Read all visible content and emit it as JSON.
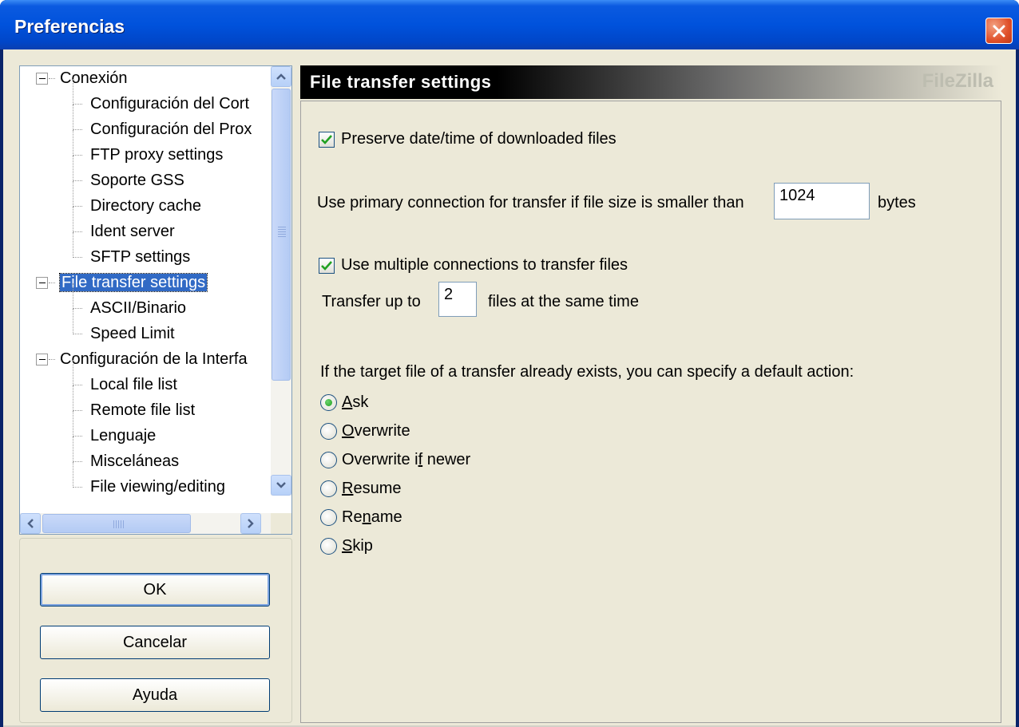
{
  "window": {
    "title": "Preferencias"
  },
  "tree": {
    "items": [
      {
        "label": "Conexión",
        "level": 0,
        "expanded": true
      },
      {
        "label": "Configuración del Cort",
        "level": 1
      },
      {
        "label": "Configuración del Prox",
        "level": 1
      },
      {
        "label": "FTP proxy settings",
        "level": 1
      },
      {
        "label": "Soporte GSS",
        "level": 1
      },
      {
        "label": "Directory cache",
        "level": 1
      },
      {
        "label": "Ident server",
        "level": 1
      },
      {
        "label": "SFTP settings",
        "level": 1
      },
      {
        "label": "File transfer settings",
        "level": 0,
        "expanded": true,
        "selected": true
      },
      {
        "label": "ASCII/Binario",
        "level": 1
      },
      {
        "label": "Speed Limit",
        "level": 1
      },
      {
        "label": "Configuración de la Interfa",
        "level": 0,
        "expanded": true
      },
      {
        "label": "Local file list",
        "level": 1
      },
      {
        "label": "Remote file list",
        "level": 1
      },
      {
        "label": "Lenguaje",
        "level": 1
      },
      {
        "label": "Misceláneas",
        "level": 1
      },
      {
        "label": "File viewing/editing",
        "level": 1
      }
    ]
  },
  "buttons": {
    "ok": "OK",
    "cancel": "Cancelar",
    "help": "Ayuda"
  },
  "page": {
    "header_title": "File transfer settings",
    "brand": "FileZilla",
    "preserve_date_label": "Preserve date/time of downloaded files",
    "preserve_date_checked": true,
    "primary_conn_prefix": "Use primary connection for transfer if file size is smaller than",
    "primary_conn_value": "1024",
    "primary_conn_suffix": "bytes",
    "multi_conn_label": "Use multiple connections to transfer files",
    "multi_conn_checked": true,
    "transfer_up_prefix": "Transfer up to",
    "transfer_up_value": "2",
    "transfer_up_suffix": "files at the same time",
    "exists_label": "If the target file of a transfer already exists, you can specify a default action:",
    "actions": [
      {
        "label": "Ask",
        "accel": 0,
        "selected": true
      },
      {
        "label": "Overwrite",
        "accel": 0,
        "selected": false
      },
      {
        "label": "Overwrite if newer",
        "accel": 11,
        "selected": false
      },
      {
        "label": "Resume",
        "accel": 0,
        "selected": false
      },
      {
        "label": "Rename",
        "accel": 2,
        "selected": false
      },
      {
        "label": "Skip",
        "accel": 0,
        "selected": false
      }
    ]
  },
  "colors": {
    "titlebar": "#0052dc",
    "selection": "#316ac5",
    "dialog_bg": "#ece9d8",
    "check": "#21a121"
  }
}
